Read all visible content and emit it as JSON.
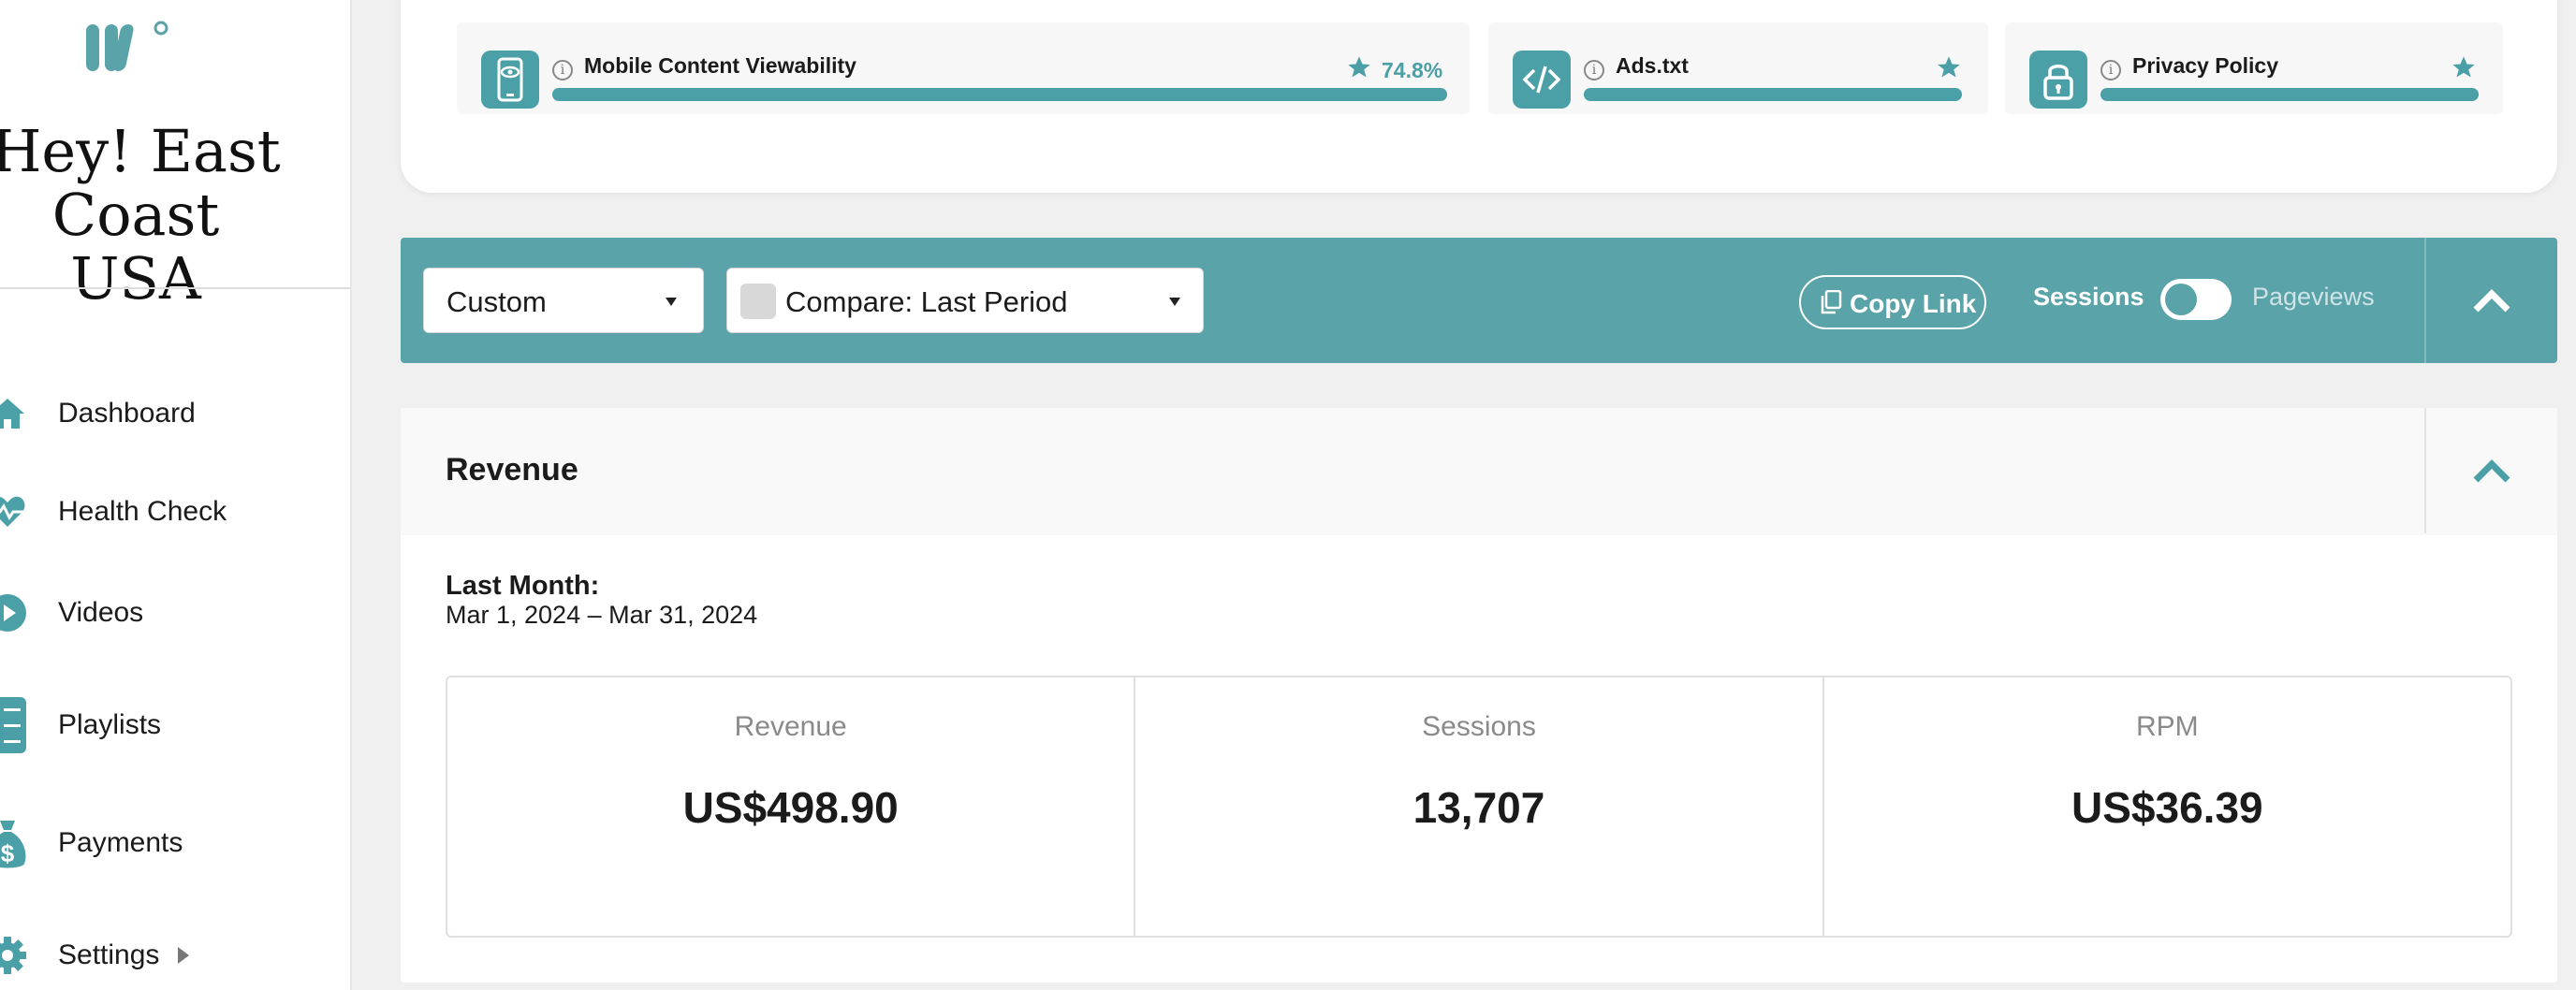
{
  "sidebar": {
    "site_title": "Hey! East Coast USA",
    "items": [
      {
        "label": "Dashboard",
        "icon": "home-icon"
      },
      {
        "label": "Health Check",
        "icon": "heart-pulse-icon"
      },
      {
        "label": "Videos",
        "icon": "play-icon"
      },
      {
        "label": "Playlists",
        "icon": "list-icon"
      },
      {
        "label": "Payments",
        "icon": "money-bag-icon"
      },
      {
        "label": "Settings",
        "icon": "gear-icon"
      }
    ]
  },
  "health_check": {
    "tiles": [
      {
        "title": "Mobile Content Viewability",
        "score": "74.8%",
        "icon": "mobile-eye-icon"
      },
      {
        "title": "Ads.txt",
        "icon": "code-icon"
      },
      {
        "title": "Privacy Policy",
        "icon": "lock-icon"
      }
    ]
  },
  "filter_bar": {
    "date_range": "Custom",
    "compare": "Compare: Last Period",
    "copy_link": "Copy Link",
    "toggle_left": "Sessions",
    "toggle_right": "Pageviews"
  },
  "revenue": {
    "title": "Revenue",
    "period_label": "Last Month:",
    "period_range": "Mar 1, 2024 – Mar 31, 2024",
    "stats": [
      {
        "label": "Revenue",
        "value": "US$498.90"
      },
      {
        "label": "Sessions",
        "value": "13,707"
      },
      {
        "label": "RPM",
        "value": "US$36.39"
      }
    ]
  },
  "colors": {
    "accent": "#5aa3a9",
    "icon_teal": "#4aa0a6"
  }
}
